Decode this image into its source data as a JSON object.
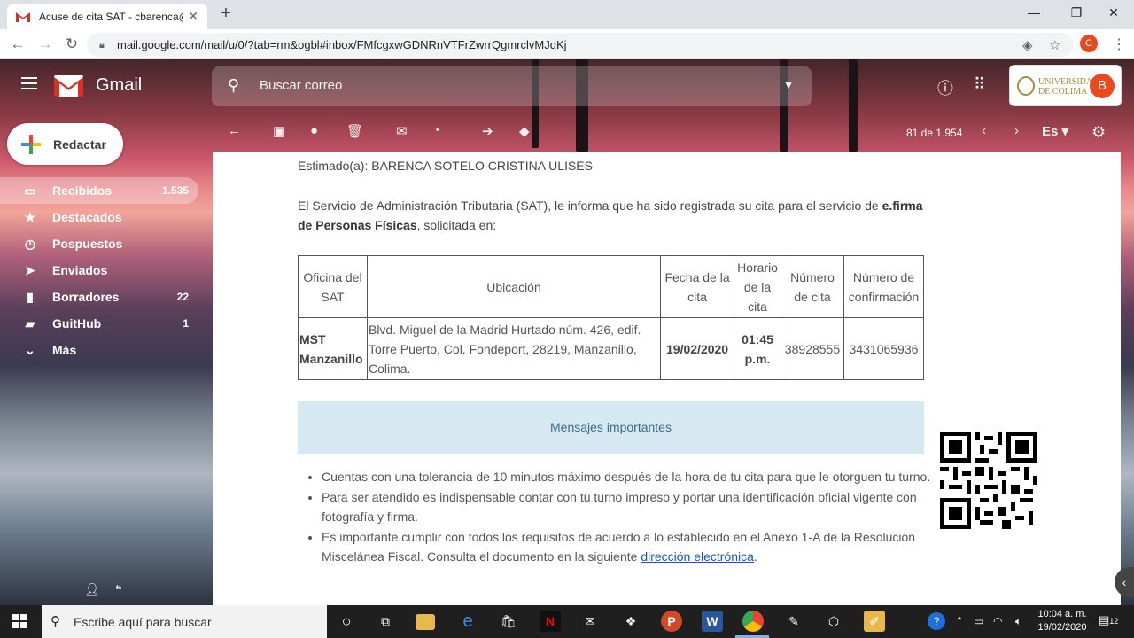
{
  "browser": {
    "tab_title": "Acuse de cita SAT - cbarenca@uc",
    "tab_close": "✕",
    "new_tab": "+",
    "url": "mail.google.com/mail/u/0/?tab=rm&ogbl#inbox/FMfcgxwGDNRnVTFrZwrrQgmrclvMJqKj",
    "profile_initial": "C",
    "minimize": "—",
    "maximize": "❐",
    "close": "✕"
  },
  "gmail": {
    "product": "Gmail",
    "search_placeholder": "Buscar correo",
    "org_name_line1": "UNIVERSIDAD",
    "org_name_line2": "DE COLIMA",
    "account_initial": "B",
    "compose_label": "Redactar",
    "nav": [
      {
        "label": "Recibidos",
        "count": "1.535",
        "icon": "inbox-icon",
        "selected": true
      },
      {
        "label": "Destacados",
        "count": "",
        "icon": "star-icon"
      },
      {
        "label": "Pospuestos",
        "count": "",
        "icon": "clock-icon"
      },
      {
        "label": "Enviados",
        "count": "",
        "icon": "send-icon"
      },
      {
        "label": "Borradores",
        "count": "22",
        "icon": "draft-icon"
      },
      {
        "label": "GuitHub",
        "count": "1",
        "icon": "label-icon"
      },
      {
        "label": "Más",
        "count": "",
        "icon": "chevron-down-icon"
      }
    ],
    "pager": "81 de 1.954",
    "lang": "Es"
  },
  "email": {
    "greeting": "Estimado(a): BARENCA SOTELO CRISTINA ULISES",
    "intro_1": "El Servicio de Administración Tributaria (SAT), le informa que ha sido registrada su cita para el servicio de",
    "intro_bold": "e.firma de Personas Físicas",
    "intro_2": ", solicitada en:",
    "table": {
      "headers": [
        "Oficina del SAT",
        "Ubicación",
        "Fecha de la cita",
        "Horario de la cita",
        "Número de cita",
        "Número de confirmación"
      ],
      "row": {
        "oficina": "MST Manzanillo",
        "ubicacion": "Blvd. Miguel de la Madrid Hurtado núm. 426, edif. Torre Puerto, Col. Fondeport, 28219, Manzanillo, Colima.",
        "fecha": "19/02/2020",
        "horario": "01:45 p.m.",
        "numero": "38928555",
        "confirmacion": "3431065936"
      }
    },
    "banner": "Mensajes importantes",
    "bullets": [
      "Cuentas con una tolerancia de 10 minutos máximo después de la hora de tu cita para que le otorguen tu turno.",
      "Para ser atendido es indispensable contar con tu turno impreso y portar una identificación oficial vigente con fotografía y firma.",
      "Es importante cumplir con todos los requisitos de acuerdo a lo establecido en el Anexo 1-A de la Resolución Miscelánea Fiscal. Consulta el documento en la siguiente "
    ],
    "link_text": "dirección electrónica",
    "link_suffix": "."
  },
  "taskbar": {
    "search_placeholder": "Escribe aquí para buscar",
    "time": "10:04 a. m.",
    "date": "19/02/2020",
    "notification_count": "12"
  }
}
